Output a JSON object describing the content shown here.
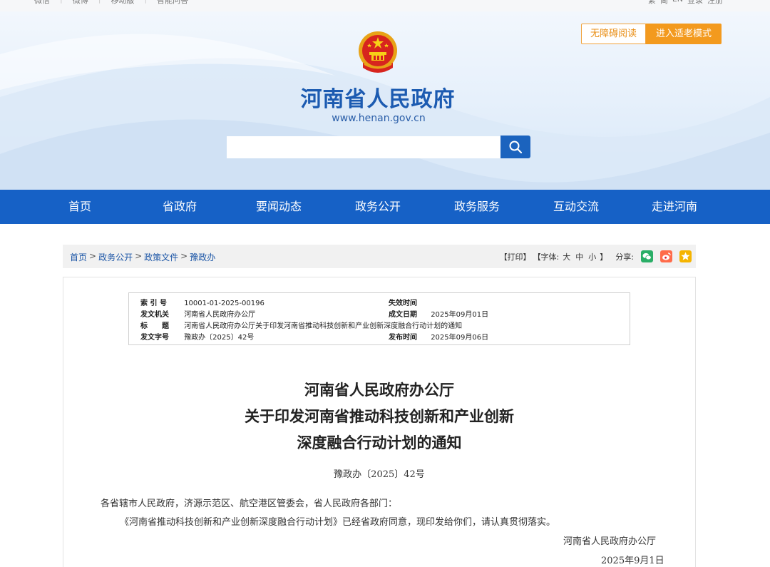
{
  "top_strip": {
    "left_items": [
      "微信",
      "微博",
      "移动版",
      "智能问答"
    ],
    "right_items": [
      "繁",
      "简",
      "EN",
      "登录",
      "注册"
    ]
  },
  "accessibility": {
    "barrier_free_label": "无障碍阅读",
    "elder_mode_label": "进入适老模式"
  },
  "header": {
    "site_title": "河南省人民政府",
    "site_url": "www.henan.gov.cn",
    "search_placeholder": ""
  },
  "nav": {
    "items": [
      {
        "label": "首页"
      },
      {
        "label": "省政府"
      },
      {
        "label": "要闻动态"
      },
      {
        "label": "政务公开"
      },
      {
        "label": "政务服务"
      },
      {
        "label": "互动交流"
      },
      {
        "label": "走进河南"
      }
    ]
  },
  "breadcrumb": [
    "首页",
    "政务公开",
    "政策文件",
    "豫政办"
  ],
  "tools": {
    "print": "【打印】",
    "font_label": "【字体:",
    "font_large": "大",
    "font_medium": "中",
    "font_small": "小",
    "font_end": "】",
    "share_label": "分享:"
  },
  "colors": {
    "nav_bg": "#1661c6",
    "title_blue": "#1c5bb1",
    "accent_orange": "#f39a1e",
    "wechat": "#2aae67",
    "weibo": "#e6162d",
    "qzone": "#f5b400"
  },
  "meta": {
    "index_label": "索 引 号",
    "index_value": "10001-01-2025-00196",
    "expire_label": "失效时间",
    "expire_value": "",
    "issuer_label": "发文机关",
    "issuer_value": "河南省人民政府办公厅",
    "date_label": "成文日期",
    "date_value": "2025年09月01日",
    "title_label": "标　　题",
    "title_value": "河南省人民政府办公厅关于印发河南省推动科技创新和产业创新深度融合行动计划的通知",
    "docno_label": "发文字号",
    "docno_value": "豫政办〔2025〕42号",
    "publish_label": "发布时间",
    "publish_value": "2025年09月06日"
  },
  "document": {
    "title_line1": "河南省人民政府办公厅",
    "title_line2": "关于印发河南省推动科技创新和产业创新",
    "title_line3": "深度融合行动计划的通知",
    "doc_number": "豫政办〔2025〕42号",
    "addressee": "各省辖市人民政府，济源示范区、航空港区管委会，省人民政府各部门：",
    "body": "《河南省推动科技创新和产业创新深度融合行动计划》已经省政府同意，现印发给你们，请认真贯彻落实。",
    "signature": "河南省人民政府办公厅",
    "sign_date": "2025年9月1日"
  }
}
